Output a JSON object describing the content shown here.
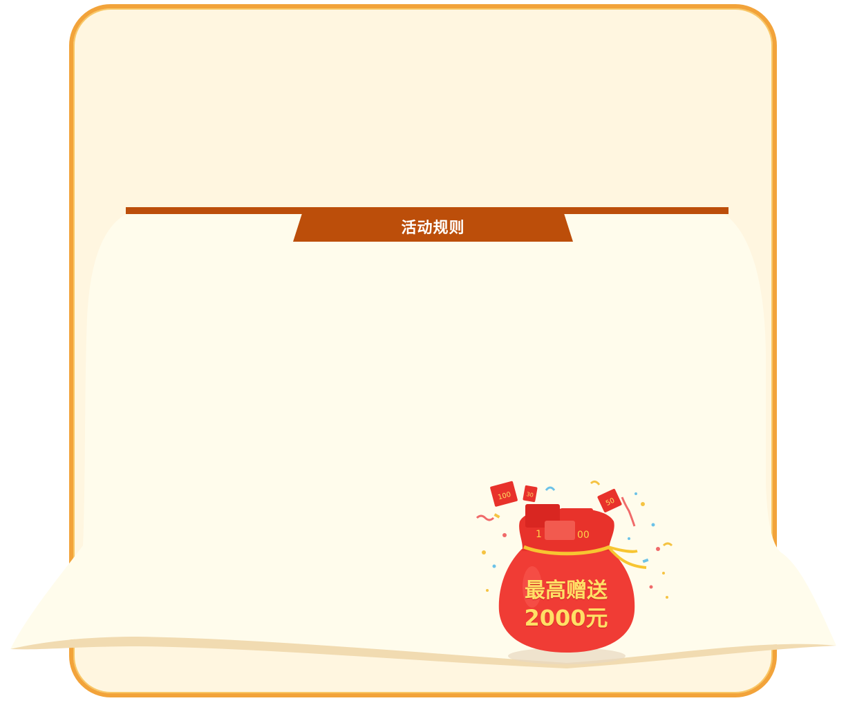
{
  "section": {
    "title": "活动规则"
  },
  "promo": {
    "line1": "最高赠送",
    "line2": "2000元",
    "envelope_labels": [
      "100",
      "30",
      "50",
      "1",
      "00",
      "10"
    ]
  },
  "colors": {
    "frame_border": "#f2a33a",
    "frame_bg": "#fff6e0",
    "paper_bg": "#fffcec",
    "title_bar": "#bc4e0a",
    "bag_red": "#f03c35",
    "bag_text": "#ffe066"
  },
  "icons": {
    "bag": "red-money-bag-icon",
    "envelope": "red-envelope-icon",
    "confetti": "confetti-icon"
  }
}
